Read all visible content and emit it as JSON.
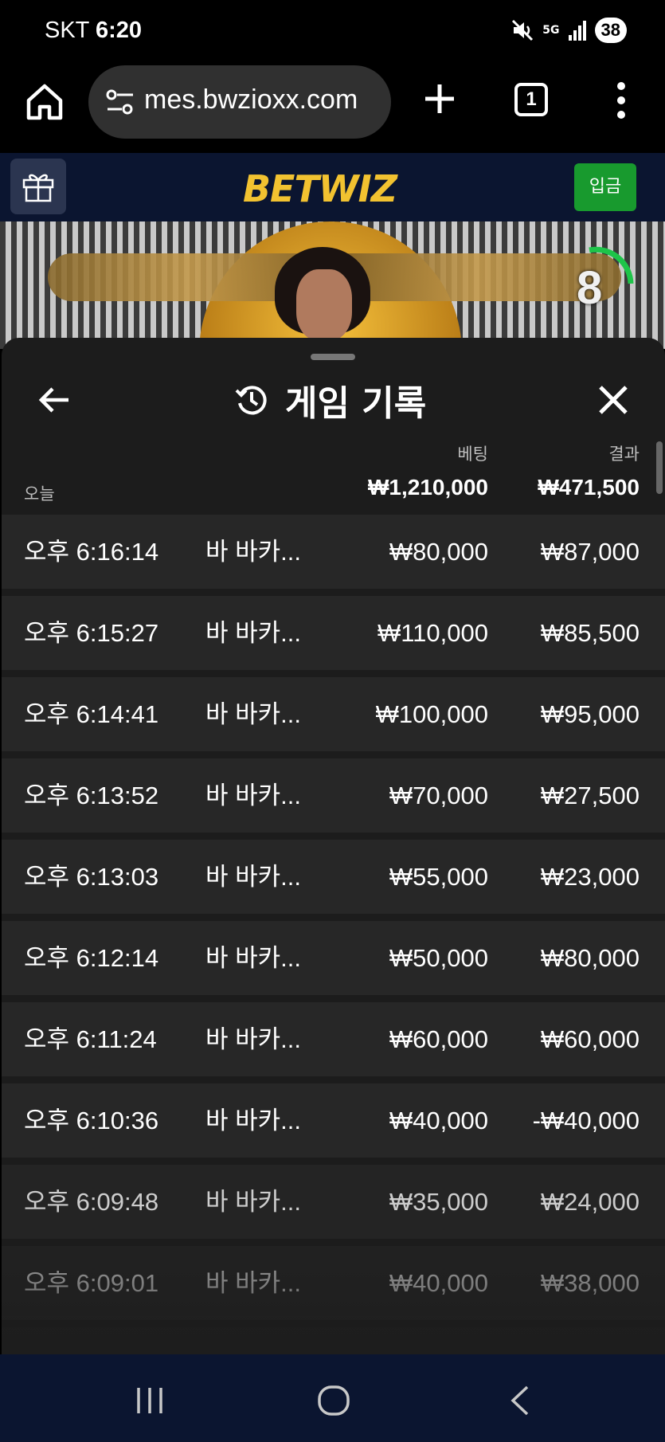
{
  "status": {
    "carrier": "SKT",
    "time": "6:20",
    "signal_label": "5G",
    "battery": "38"
  },
  "browser": {
    "url": "mes.bwzioxx.com",
    "tab_count": "1"
  },
  "site": {
    "logo_part1": "BET",
    "logo_part2": "WIZ",
    "deposit_label": "입금"
  },
  "video": {
    "timer": "8"
  },
  "sheet": {
    "title": "게임 기록",
    "bet_header": "베팅",
    "result_header": "결과",
    "day_label": "오늘",
    "total_bet": "₩1,210,000",
    "total_result": "₩471,500"
  },
  "rows": [
    {
      "time": "오후 6:16:14",
      "game": "바 바카...",
      "bet": "₩80,000",
      "result": "₩87,000"
    },
    {
      "time": "오후 6:15:27",
      "game": "바 바카...",
      "bet": "₩110,000",
      "result": "₩85,500"
    },
    {
      "time": "오후 6:14:41",
      "game": "바 바카...",
      "bet": "₩100,000",
      "result": "₩95,000"
    },
    {
      "time": "오후 6:13:52",
      "game": "바 바카...",
      "bet": "₩70,000",
      "result": "₩27,500"
    },
    {
      "time": "오후 6:13:03",
      "game": "바 바카...",
      "bet": "₩55,000",
      "result": "₩23,000"
    },
    {
      "time": "오후 6:12:14",
      "game": "바 바카...",
      "bet": "₩50,000",
      "result": "₩80,000"
    },
    {
      "time": "오후 6:11:24",
      "game": "바 바카...",
      "bet": "₩60,000",
      "result": "₩60,000"
    },
    {
      "time": "오후 6:10:36",
      "game": "바 바카...",
      "bet": "₩40,000",
      "result": "-₩40,000"
    },
    {
      "time": "오후 6:09:48",
      "game": "바 바카...",
      "bet": "₩35,000",
      "result": "₩24,000"
    },
    {
      "time": "오후 6:09:01",
      "game": "바 바카...",
      "bet": "₩40,000",
      "result": "₩38,000"
    }
  ],
  "icons": {
    "home": "home-icon",
    "tune": "tune-icon",
    "plus": "plus-icon",
    "menu": "more-vert-icon",
    "gift": "gift-icon",
    "back": "arrow-left-icon",
    "history": "history-icon",
    "close": "close-icon",
    "nav_recents": "recents-icon",
    "nav_home": "nav-home-icon",
    "nav_back": "nav-back-icon"
  },
  "colors": {
    "accent_gold": "#f2c230",
    "deposit_green": "#189a2e",
    "header_navy": "#0b1530",
    "row_bg": "#272727"
  }
}
